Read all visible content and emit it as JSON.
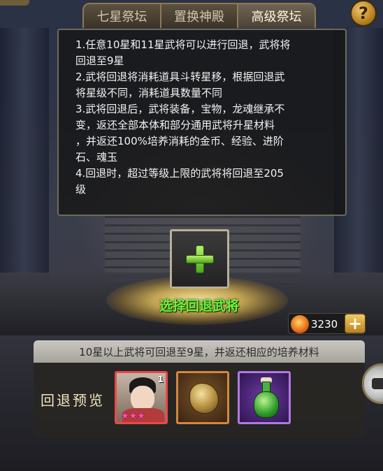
{
  "tabs": [
    {
      "label": "七星祭坛",
      "active": false
    },
    {
      "label": "置换神殿",
      "active": false
    },
    {
      "label": "高级祭坛",
      "active": true
    }
  ],
  "help_button": {
    "label": "?",
    "icon": "question-icon"
  },
  "info": {
    "lines": [
      "1.任意10星和11星武将可以进行回退，武将将",
      "回退至9星",
      "2.武将回退将消耗道具斗转星移，根据回退武",
      "将星级不同，消耗道具数量不同",
      "3.武将回退后，武将装备，宝物，龙魂继承不",
      "变，返还全部本体和部分通用武将升星材料",
      "，并返还100%培养消耗的金币、经验、进阶",
      "石、魂玉",
      "4.回退时，超过等级上限的武将将回退至205",
      "级"
    ]
  },
  "add_slot": {
    "icon": "plus-icon",
    "label": "选择回退武将"
  },
  "currency": {
    "icon": "flame-coin-icon",
    "value": "3230",
    "add_label": "+"
  },
  "bottom": {
    "notice": "10星以上武将可回退至9星，并返还相应的培养材料",
    "preview_label": "回退预览",
    "items": [
      {
        "name": "hero",
        "level": "1",
        "stars": "★★★"
      },
      {
        "name": "gold-ore"
      },
      {
        "name": "green-potion"
      }
    ]
  },
  "colors": {
    "select_label": "#6ef13a",
    "tab_border": "#8d7a52",
    "hero_frame": "#e94a4a",
    "ore_frame": "#d4873f",
    "potion_frame": "#b07ae0"
  }
}
